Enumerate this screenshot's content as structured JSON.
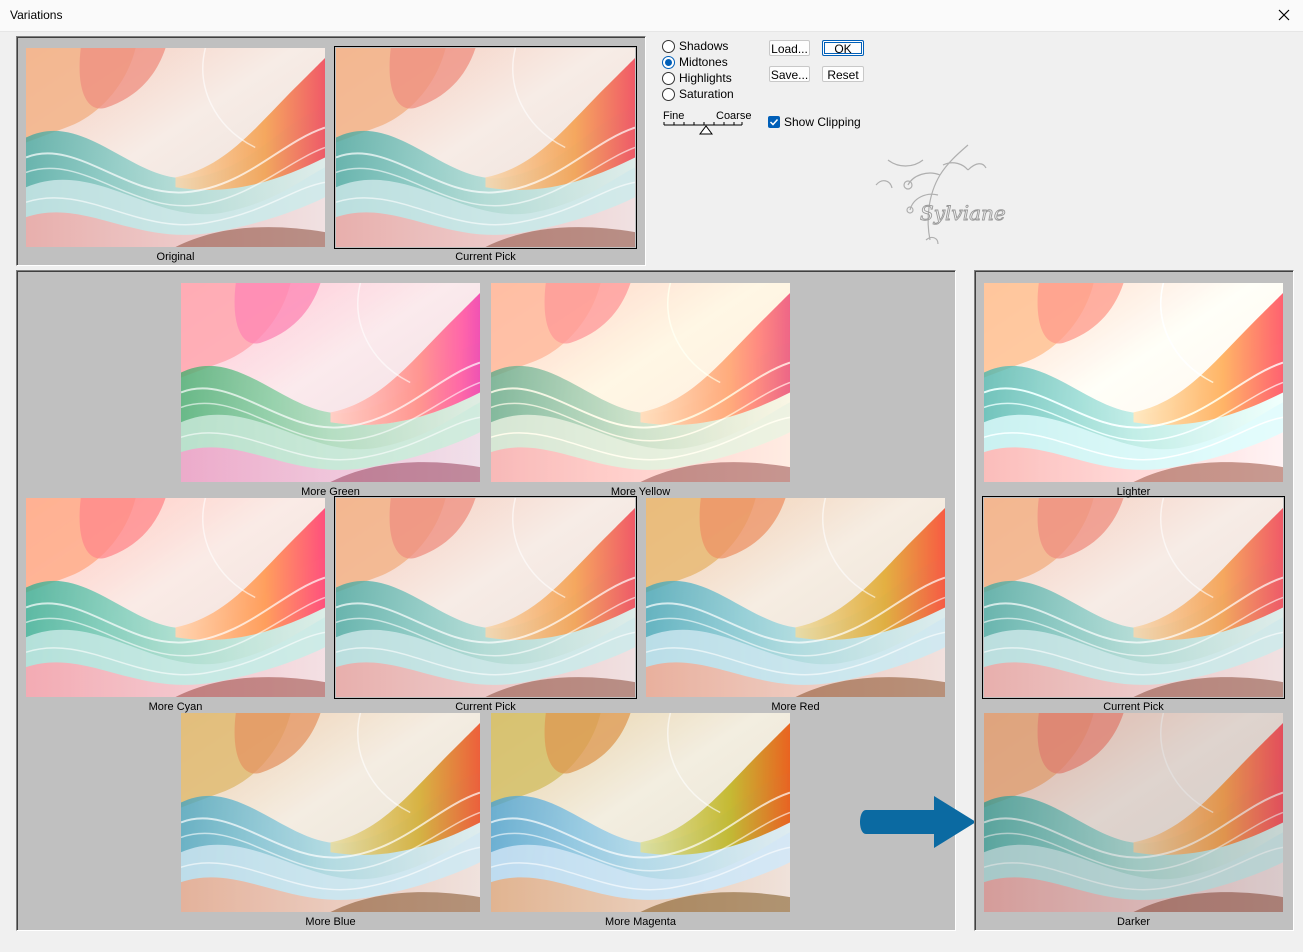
{
  "window": {
    "title": "Variations"
  },
  "options": {
    "radios": [
      {
        "label": "Shadows",
        "checked": false
      },
      {
        "label": "Midtones",
        "checked": true
      },
      {
        "label": "Highlights",
        "checked": false
      },
      {
        "label": "Saturation",
        "checked": false
      }
    ],
    "slider": {
      "min_label": "Fine",
      "max_label": "Coarse"
    },
    "show_clipping": {
      "label": "Show Clipping",
      "checked": true
    }
  },
  "buttons": {
    "load": "Load...",
    "ok": "OK",
    "save": "Save...",
    "reset": "Reset"
  },
  "watermark": "Sylviane",
  "preview": {
    "original": "Original",
    "current": "Current Pick"
  },
  "color_grid": {
    "more_green": "More Green",
    "more_yellow": "More Yellow",
    "more_cyan": "More Cyan",
    "current": "Current Pick",
    "more_red": "More Red",
    "more_blue": "More Blue",
    "more_magenta": "More Magenta"
  },
  "brightness": {
    "lighter": "Lighter",
    "current": "Current Pick",
    "darker": "Darker"
  },
  "colors": {
    "accent": "#005fb8",
    "panel": "#c0c0c0",
    "arrow": "#0b6aa2"
  }
}
